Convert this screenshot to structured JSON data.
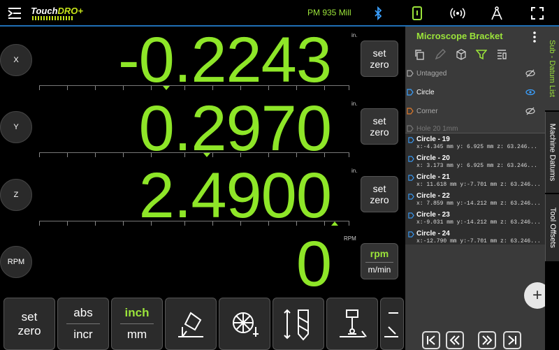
{
  "topbar": {
    "logo_main": "Touch",
    "logo_accent": "DRO+",
    "machine": "PM 935 Mill",
    "icons": [
      "menu-icon",
      "bluetooth-icon",
      "device-icon",
      "broadcast-icon",
      "compass-icon",
      "fullscreen-icon"
    ]
  },
  "axes": [
    {
      "label": "X",
      "value": "-0.2243",
      "unit": "in.",
      "set_line1": "set",
      "set_line2": "zero"
    },
    {
      "label": "Y",
      "value": "0.2970",
      "unit": "in.",
      "set_line1": "set",
      "set_line2": "zero"
    },
    {
      "label": "Z",
      "value": "2.4900",
      "unit": "in.",
      "set_line1": "set",
      "set_line2": "zero"
    },
    {
      "label": "RPM",
      "value": "0",
      "unit": "RPM",
      "set_line1": "rpm",
      "set_line2": "m/min"
    }
  ],
  "toolbar": {
    "set_zero_1": "set",
    "set_zero_2": "zero",
    "abs": "abs",
    "incr": "incr",
    "inch": "inch",
    "mm": "mm"
  },
  "panel": {
    "title": "Microscope Bracket",
    "tags": [
      {
        "label": "Untagged",
        "active": false
      },
      {
        "label": "Circle",
        "active": true
      },
      {
        "label": "Corner",
        "active": false
      },
      {
        "label": "Hole 20 1mm",
        "active": false
      }
    ],
    "datums": [
      {
        "name": "Circle - 19",
        "coords": "x:-4.345 mm y: 6.925 mm z: 63.246..."
      },
      {
        "name": "Circle - 20",
        "coords": "x: 3.173 mm y: 6.925 mm z: 63.246..."
      },
      {
        "name": "Circle - 21",
        "coords": "x: 11.618 mm y:-7.701 mm z: 63.246..."
      },
      {
        "name": "Circle - 22",
        "coords": "x: 7.859 mm y:-14.212 mm z: 63.246..."
      },
      {
        "name": "Circle - 23",
        "coords": "x:-9.031 mm y:-14.212 mm z: 63.246..."
      },
      {
        "name": "Circle - 24",
        "coords": "x:-12.790 mm y:-7.701 mm z: 63.246..."
      }
    ],
    "fab": "+"
  },
  "vtabs": {
    "sub_datum": "Sub - Datum  List",
    "machine": "Machine Datums",
    "tool": "Tool Offsets"
  },
  "colors": {
    "readout": "#8ee628",
    "accent": "#9be33a",
    "topbar_line": "#1f6fb5"
  }
}
